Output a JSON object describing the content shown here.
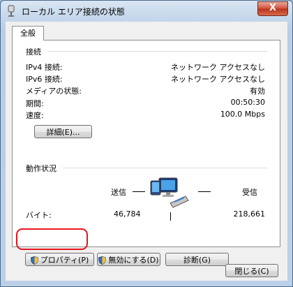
{
  "window": {
    "title": "ローカル エリア接続の状態",
    "close_label": "X"
  },
  "tabs": [
    {
      "label": "全般"
    }
  ],
  "connection": {
    "section_title": "接続",
    "rows": [
      {
        "label": "IPv4 接続:",
        "value": "ネットワーク アクセスなし"
      },
      {
        "label": "IPv6 接続:",
        "value": "ネットワーク アクセスなし"
      },
      {
        "label": "メディアの状態:",
        "value": "有効"
      },
      {
        "label": "期間:",
        "value": "00:50:30"
      },
      {
        "label": "速度:",
        "value": "100.0 Mbps"
      }
    ],
    "details_button": "詳細(E)..."
  },
  "activity": {
    "section_title": "動作状況",
    "sent_label": "送信",
    "received_label": "受信",
    "bytes_label": "バイト:",
    "bytes_sent": "46,784",
    "bytes_received": "218,661"
  },
  "buttons": {
    "properties": "プロパティ(P)",
    "disable": "無効にする(D)",
    "diagnose": "診断(G)",
    "close": "閉じる(C)"
  }
}
